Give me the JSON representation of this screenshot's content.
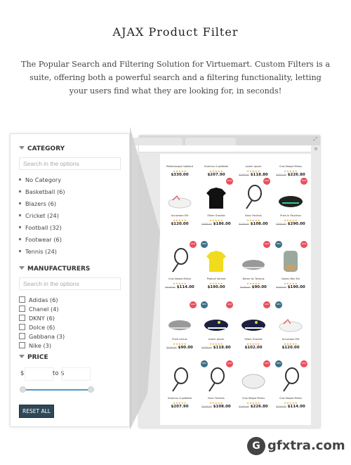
{
  "header": {
    "title": "AJAX Product Filter",
    "description": "The Popular Search and Filtering Solution for Virtuemart. Custom Filters is a suite, offering both a powerful search and a filtering functionality, letting your users find what they are looking for, in seconds!"
  },
  "filter": {
    "category": {
      "title": "CATEGORY",
      "search_placeholder": "Search in the options",
      "items": [
        "No Category",
        "Basketball (6)",
        "Blazers (6)",
        "Cricket (24)",
        "Football (32)",
        "Footwear (6)",
        "Tennis (24)"
      ]
    },
    "manufacturers": {
      "title": "MANUFACTURERS",
      "search_placeholder": "Search in the options",
      "items": [
        "Adidas (6)",
        "Chanel (4)",
        "DKNY (6)",
        "Dolce (6)",
        "Gabbana (3)",
        "Nike (3)"
      ]
    },
    "price": {
      "title": "PRICE",
      "from_prefix": "$",
      "to_label": "to $",
      "from_value": "",
      "to_value": ""
    },
    "reset_label": "RESET ALL"
  },
  "products": [
    {
      "name": "Pellentesque habitant",
      "price": "$330.00",
      "old": "",
      "type": "none",
      "badges": []
    },
    {
      "name": "Vivamus Cupiditate",
      "price": "$207.90",
      "old": "",
      "type": "none",
      "badges": []
    },
    {
      "name": "Lorem Ipsum",
      "price": "$118.80",
      "old": "$135.00",
      "type": "none",
      "badges": []
    },
    {
      "name": "Cras Neque Metus",
      "price": "$226.80",
      "old": "$252.00",
      "type": "none",
      "badges": []
    },
    {
      "name": "Accumsan Elit",
      "price": "$120.00",
      "old": "",
      "type": "shoe-white",
      "badges": []
    },
    {
      "name": "Etiam Gravida",
      "price": "$186.00",
      "old": "$200.00",
      "type": "shirt-black",
      "badges": [
        "sale"
      ]
    },
    {
      "name": "Nunc Facilisis",
      "price": "$108.00",
      "old": "$120.00",
      "type": "racket",
      "badges": [
        "sale"
      ]
    },
    {
      "name": "Proin In Faucibus",
      "price": "$290.00",
      "old": "$300.00",
      "type": "shoe-black",
      "badges": [
        "sale"
      ]
    },
    {
      "name": "Cras Neque Metus",
      "price": "$114.00",
      "old": "$120.00",
      "type": "racket",
      "badges": [
        "sale"
      ]
    },
    {
      "name": "Product Variant",
      "price": "$190.00",
      "old": "",
      "type": "shirt-yellow",
      "badges": [
        "new"
      ]
    },
    {
      "name": "Donec Ac Tempus",
      "price": "$90.00",
      "old": "$100.00",
      "type": "shoe-grey",
      "badges": [
        "sale"
      ]
    },
    {
      "name": "Donec Non Est",
      "price": "$190.00",
      "old": "$200.00",
      "type": "backpack",
      "badges": [
        "new",
        "sale"
      ]
    },
    {
      "name": "Proin Lectus",
      "price": "$90.00",
      "old": "$100.00",
      "type": "shoe-grey",
      "badges": [
        "sale"
      ]
    },
    {
      "name": "Lorem Ipsum",
      "price": "$118.80",
      "old": "$135.00",
      "type": "shoe-navy",
      "badges": [
        "new",
        "sale"
      ]
    },
    {
      "name": "Etiam Gravida",
      "price": "$102.00",
      "old": "",
      "type": "shoe-navy",
      "badges": [
        "sale"
      ]
    },
    {
      "name": "Accumsan Elit",
      "price": "$120.00",
      "old": "",
      "type": "shoe-white",
      "badges": [
        "new"
      ]
    },
    {
      "name": "Vivamus Cupiditate",
      "price": "$207.90",
      "old": "",
      "type": "racket",
      "badges": []
    },
    {
      "name": "Nunc Facilisis",
      "price": "$108.00",
      "old": "$120.00",
      "type": "racket",
      "badges": [
        "new",
        "sale"
      ]
    },
    {
      "name": "Cras Neque Metus",
      "price": "$226.80",
      "old": "$252.00",
      "type": "ball",
      "badges": [
        "sale"
      ]
    },
    {
      "name": "Cras Neque Metus",
      "price": "$114.00",
      "old": "$120.00",
      "type": "racket",
      "badges": [
        "new",
        "sale"
      ]
    }
  ],
  "stars": "★★★★★",
  "badge_labels": {
    "sale": "SALE",
    "new": "NEW"
  },
  "colors": {
    "sale": "#e8505b",
    "new": "#3e6e86",
    "reset": "#2f4858",
    "slider": "#4a9ccc"
  },
  "watermark": "gfxtra.com"
}
